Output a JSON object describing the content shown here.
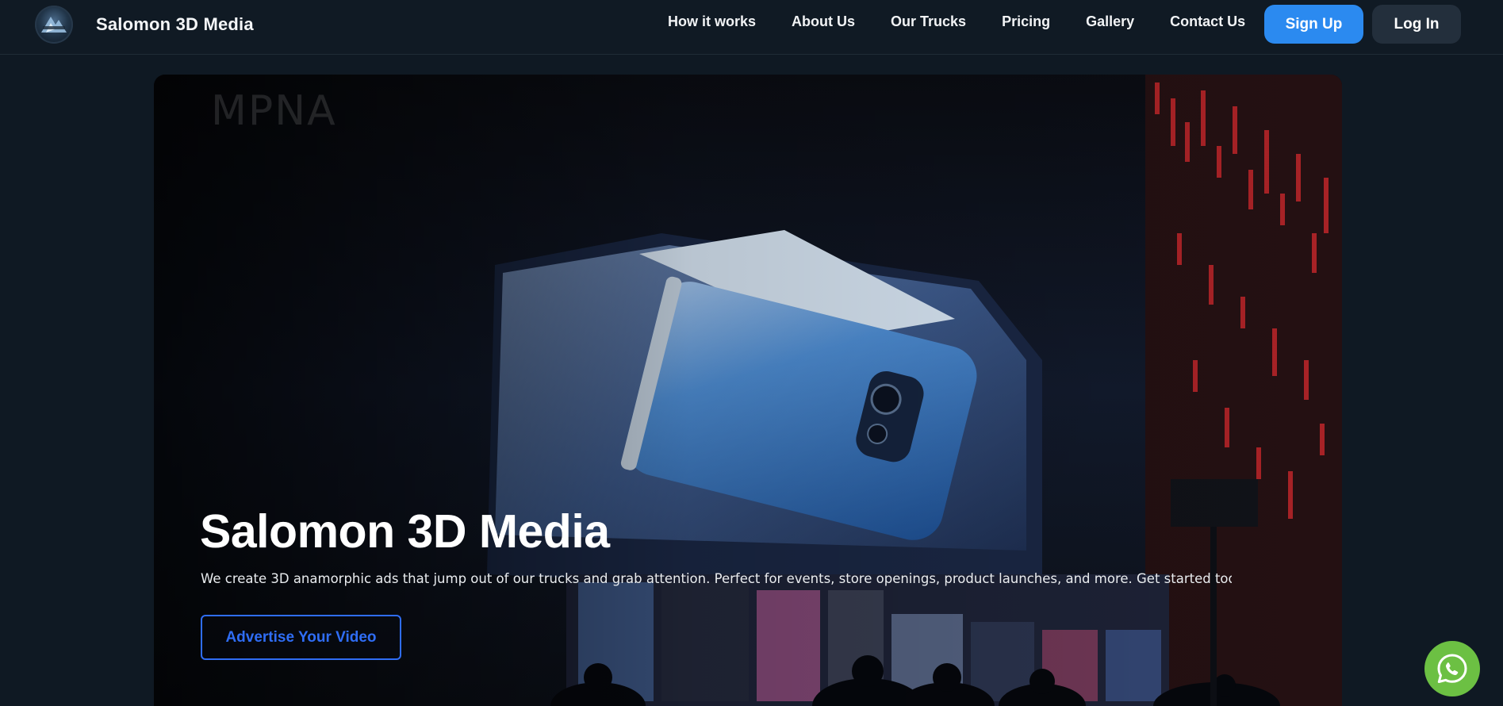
{
  "brand": {
    "name": "Salomon 3D Media",
    "logo_icon": "mountain-logo-icon"
  },
  "nav": {
    "items": [
      {
        "label": "How it works"
      },
      {
        "label": "About Us"
      },
      {
        "label": "Our Trucks"
      },
      {
        "label": "Pricing"
      },
      {
        "label": "Gallery"
      },
      {
        "label": "Contact Us"
      }
    ],
    "signup_label": "Sign Up",
    "login_label": "Log In"
  },
  "hero": {
    "watermark": "MPNA",
    "title": "Salomon 3D Media",
    "description": "We create 3D anamorphic ads that jump out of our trucks and grab attention. Perfect for events, store openings, product launches, and more. Get started tod",
    "cta_label": "Advertise Your Video",
    "image_subject": "3D anamorphic billboard showing a blue smartphone above a storefront at night"
  },
  "floating": {
    "whatsapp_icon": "whatsapp-icon"
  },
  "colors": {
    "background": "#0f1923",
    "accent_blue": "#2b8af0",
    "cta_outline": "#2f6df5",
    "login_bg": "#232f3c",
    "whatsapp_green": "#6cc043"
  }
}
